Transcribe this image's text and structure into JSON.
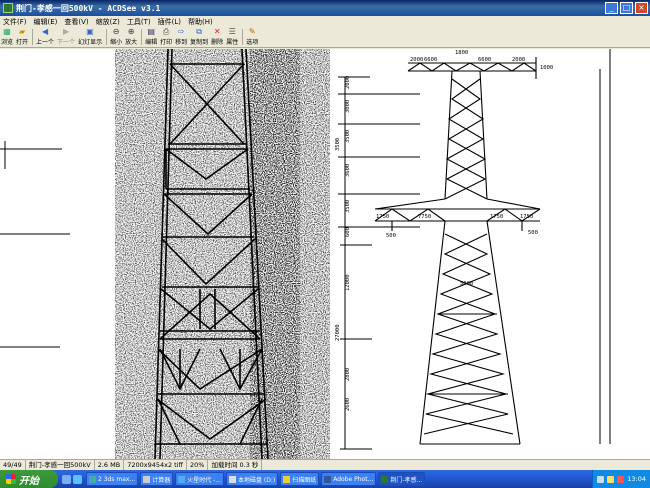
{
  "window": {
    "title": "荆门-孝感一回500kV - ACDSee v3.1",
    "buttons": {
      "minimize": "_",
      "maximize": "□",
      "close": "×"
    }
  },
  "menu": [
    "文件(F)",
    "编辑(E)",
    "查看(V)",
    "缩放(Z)",
    "工具(T)",
    "插件(L)",
    "帮助(H)"
  ],
  "toolbar": [
    {
      "name": "browse",
      "label": "浏览",
      "icon": "browse-icon"
    },
    {
      "name": "open",
      "label": "打开",
      "icon": "open-icon"
    },
    {
      "name": "prev",
      "label": "上一个",
      "icon": "prev-icon"
    },
    {
      "name": "next",
      "label": "下一个",
      "icon": "next-icon"
    },
    {
      "name": "slideshow",
      "label": "幻灯显示",
      "icon": "slideshow-icon"
    },
    {
      "name": "zoom-out",
      "label": "缩小",
      "icon": "zoom-out-icon"
    },
    {
      "name": "zoom-in",
      "label": "放大",
      "icon": "zoom-in-icon"
    },
    {
      "name": "edit",
      "label": "编辑",
      "icon": "edit-icon"
    },
    {
      "name": "print",
      "label": "打印",
      "icon": "print-icon"
    },
    {
      "name": "move",
      "label": "移到",
      "icon": "move-icon"
    },
    {
      "name": "copy",
      "label": "复制到",
      "icon": "copy-icon"
    },
    {
      "name": "delete",
      "label": "删除",
      "icon": "delete-icon"
    },
    {
      "name": "properties",
      "label": "属性",
      "icon": "properties-icon"
    },
    {
      "name": "options",
      "label": "选项",
      "icon": "options-icon"
    }
  ],
  "drawing": {
    "dims_top": [
      "1800",
      "6600",
      "6600",
      "2000",
      "2000",
      "1000"
    ],
    "dims_left": [
      "2000",
      "3000",
      "3500",
      "3600",
      "3500",
      "3500",
      "600",
      "27000",
      "12000",
      "2800",
      "2600"
    ],
    "dims_mid": [
      "1750",
      "1750",
      "7750",
      "1750",
      "500",
      "500",
      "5000"
    ]
  },
  "status": {
    "index": "49/49",
    "file": "荆门-孝感一回500kV",
    "size": "2.6 MB",
    "dims": "7200x9454x2 tiff",
    "zoom": "20%",
    "load": "加载时间 0.3 秒"
  },
  "taskbar": {
    "start": "开始",
    "items": [
      {
        "label": "2 3ds max...",
        "active": false
      },
      {
        "label": "计算器",
        "active": false
      },
      {
        "label": "火星时代 -...",
        "active": false
      },
      {
        "label": "本地磁盘 (D:)",
        "active": false
      },
      {
        "label": "扫描图纸",
        "active": false
      },
      {
        "label": "Adobe Phot...",
        "active": false
      },
      {
        "label": "荆门-孝感...",
        "active": true
      }
    ],
    "clock": "13:04"
  },
  "colors": {
    "titlebar": "#0a246a",
    "taskbar": "#245edb",
    "start": "#2e8b2e"
  }
}
